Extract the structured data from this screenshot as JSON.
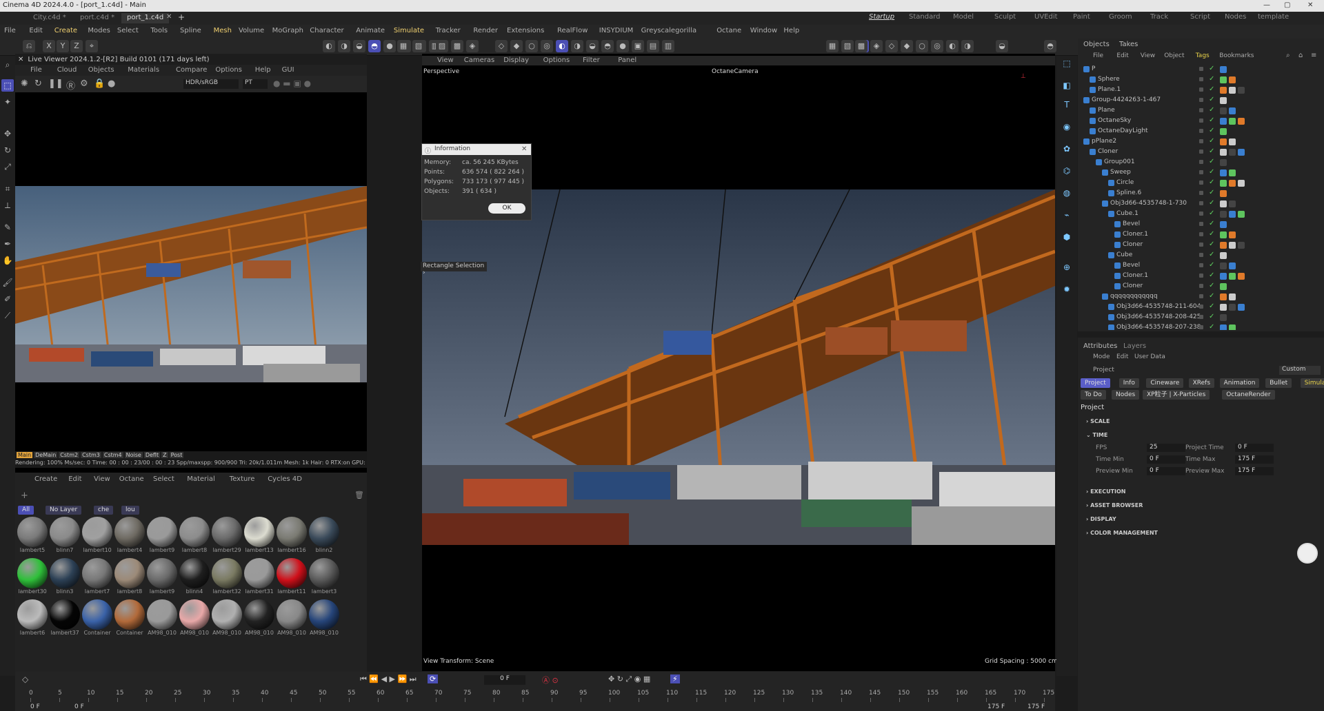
{
  "window": {
    "title": "Cinema 4D 2024.4.0 - [port_1.c4d] - Main"
  },
  "file_tabs": [
    "City.c4d *",
    "port.c4d *",
    "port_1.c4d"
  ],
  "layouts": [
    "Startup",
    "Standard",
    "Model",
    "Sculpt",
    "UVEdit",
    "Paint",
    "Groom",
    "Track",
    "Script",
    "Nodes",
    "template"
  ],
  "menu": [
    "File",
    "Edit",
    "Create",
    "Modes",
    "Select",
    "Tools",
    "Spline",
    "Mesh",
    "Volume",
    "MoGraph",
    "Character",
    "Animate",
    "Simulate",
    "Tracker",
    "Render",
    "Extensions",
    "RealFlow",
    "INSYDIUM",
    "Greyscalegorilla",
    "Octane",
    "Window",
    "Help"
  ],
  "coords": {
    "x": "X",
    "y": "Y",
    "z": "Z"
  },
  "live_viewer": {
    "title": "Live Viewer 2024.1.2-[R2] Build 0101 (171 days left)",
    "menu": [
      "File",
      "Cloud",
      "Objects",
      "Materials",
      "Compare",
      "Options",
      "Help",
      "GUI"
    ],
    "color_space": "HDR/sRGB",
    "pt": "PT",
    "chips": [
      "Main",
      "DeMain",
      "Cstm2",
      "Cstm3",
      "Cstm4",
      "Noise",
      "Deflt",
      "Z",
      "Post"
    ],
    "status": "Rendering: 100%  Ms/sec: 0  Time: 00 : 00 : 23/00 : 00 : 23  Spp/maxspp: 900/900    Tri: 20k/1.011m  Mesh: 1k  Hair: 0  RTX:on    GPU:"
  },
  "materials": {
    "menu": [
      "Create",
      "Edit",
      "View",
      "Octane",
      "Select",
      "Material",
      "Texture",
      "Cycles 4D"
    ],
    "filters": [
      "All",
      "No Layer",
      "che",
      "lou"
    ],
    "items": [
      {
        "name": "lambert5",
        "color": "#7a7a7a"
      },
      {
        "name": "blinn7",
        "color": "#8a8a8a"
      },
      {
        "name": "lambert10",
        "color": "#a0a0a0"
      },
      {
        "name": "lambert4",
        "color": "#6e6a62"
      },
      {
        "name": "lambert9",
        "color": "#9a9a9a"
      },
      {
        "name": "lambert8",
        "color": "#8c8c8c"
      },
      {
        "name": "lambert29",
        "color": "#6a6a6a"
      },
      {
        "name": "lambert13",
        "color": "#dcdcd0"
      },
      {
        "name": "lambert16",
        "color": "#7a7a72"
      },
      {
        "name": "blinn2",
        "color": "#3a4a5a"
      },
      {
        "name": "lambert30",
        "color": "#2fc03a"
      },
      {
        "name": "blinn3",
        "color": "#2c4055"
      },
      {
        "name": "lambert7",
        "color": "#777"
      },
      {
        "name": "lambert8",
        "color": "#9c8a78"
      },
      {
        "name": "lambert9",
        "color": "#6a6a6a"
      },
      {
        "name": "blinn4",
        "color": "#1e1e1e"
      },
      {
        "name": "lambert32",
        "color": "#7a7a62"
      },
      {
        "name": "lambert31",
        "color": "#9a9a9a"
      },
      {
        "name": "lambert11",
        "color": "#d0101a"
      },
      {
        "name": "lambert3",
        "color": "#5a5a5a"
      },
      {
        "name": "lambert6",
        "color": "#bbbbbb"
      },
      {
        "name": "lambert37",
        "color": "#050505"
      },
      {
        "name": "Container",
        "color": "#3a62a8"
      },
      {
        "name": "Container",
        "color": "#b26a3a"
      },
      {
        "name": "AM98_010",
        "color": "#9a9a9a"
      },
      {
        "name": "AM98_010",
        "color": "#e8a8a8"
      },
      {
        "name": "AM98_010",
        "color": "#b0b0b0"
      },
      {
        "name": "AM98_010",
        "color": "#222"
      },
      {
        "name": "AM98_010",
        "color": "#888"
      },
      {
        "name": "AM98_010",
        "color": "#26457a"
      }
    ]
  },
  "viewport": {
    "menu": [
      "View",
      "Cameras",
      "Display",
      "Options",
      "Filter",
      "Panel"
    ],
    "label": "Perspective",
    "camera": "OctaneCamera",
    "view_transform": "View Transform: Scene",
    "grid_spacing": "Grid Spacing : 5000 cm",
    "rect_selection": "Rectangle Selection"
  },
  "info_dialog": {
    "title": "Information",
    "rows": [
      {
        "k": "Memory:",
        "v": "ca. 56 245 KBytes"
      },
      {
        "k": "Points:",
        "v": "636 574 ( 822 264 )"
      },
      {
        "k": "Polygons:",
        "v": "733 173 ( 977 445 )"
      },
      {
        "k": "Objects:",
        "v": "391 ( 634 )"
      }
    ],
    "ok": "OK"
  },
  "timeline": {
    "frame": "0 F",
    "start": "0 F",
    "start2": "0 F",
    "end": "175 F",
    "end2": "175 F",
    "ticks": [
      "0",
      "5",
      "10",
      "15",
      "20",
      "25",
      "30",
      "35",
      "40",
      "45",
      "50",
      "55",
      "60",
      "65",
      "70",
      "75",
      "80",
      "85",
      "90",
      "95",
      "100",
      "105",
      "110",
      "115",
      "120",
      "125",
      "130",
      "135",
      "140",
      "145",
      "150",
      "155",
      "160",
      "165",
      "170",
      "175"
    ]
  },
  "objects_panel": {
    "tabs": [
      "Objects",
      "Takes"
    ],
    "menu": [
      "File",
      "Edit",
      "View",
      "Object",
      "Tags",
      "Bookmarks"
    ],
    "items": [
      {
        "name": "P",
        "indent": 0
      },
      {
        "name": "Sphere",
        "indent": 1
      },
      {
        "name": "Plane.1",
        "indent": 1
      },
      {
        "name": "Group-4424263-1-467",
        "indent": 0
      },
      {
        "name": "Plane",
        "indent": 1
      },
      {
        "name": "OctaneSky",
        "indent": 1
      },
      {
        "name": "OctaneDayLight",
        "indent": 1
      },
      {
        "name": "pPlane2",
        "indent": 0
      },
      {
        "name": "Cloner",
        "indent": 1
      },
      {
        "name": "Group001",
        "indent": 2
      },
      {
        "name": "Sweep",
        "indent": 3
      },
      {
        "name": "Circle",
        "indent": 4
      },
      {
        "name": "Spline.6",
        "indent": 4
      },
      {
        "name": "Obj3d66-4535748-1-730",
        "indent": 3
      },
      {
        "name": "Cube.1",
        "indent": 4
      },
      {
        "name": "Bevel",
        "indent": 5
      },
      {
        "name": "Cloner.1",
        "indent": 5
      },
      {
        "name": "Cloner",
        "indent": 5
      },
      {
        "name": "Cube",
        "indent": 4
      },
      {
        "name": "Bevel",
        "indent": 5
      },
      {
        "name": "Cloner.1",
        "indent": 5
      },
      {
        "name": "Cloner",
        "indent": 5
      },
      {
        "name": "qqqqqqqqqqqq",
        "indent": 3
      },
      {
        "name": "Obj3d66-4535748-211-604",
        "indent": 4
      },
      {
        "name": "Obj3d66-4535748-208-425",
        "indent": 4
      },
      {
        "name": "Obj3d66-4535748-207-238",
        "indent": 4
      }
    ]
  },
  "attributes": {
    "tabs": [
      "Attributes",
      "Layers"
    ],
    "menu": [
      "Mode",
      "Edit",
      "User Data"
    ],
    "project_label": "Project",
    "preset": "Custom",
    "buttons_row1": [
      "Project",
      "Info",
      "Cineware",
      "XRefs",
      "Animation",
      "Bullet",
      "Simulation"
    ],
    "buttons_row2": [
      "To Do",
      "Nodes",
      "XP粒子 | X-Particles",
      "OctaneRender"
    ],
    "section": "Project",
    "sections": [
      "SCALE",
      "TIME",
      "EXECUTION",
      "ASSET BROWSER",
      "DISPLAY",
      "COLOR MANAGEMENT"
    ],
    "fields": [
      {
        "label": "FPS",
        "value": "25"
      },
      {
        "label": "Project Time",
        "value": "0 F"
      },
      {
        "label": "Time Min",
        "value": "0 F"
      },
      {
        "label": "Time Max",
        "value": "175 F"
      },
      {
        "label": "Preview Min",
        "value": "0 F"
      },
      {
        "label": "Preview Max",
        "value": "175 F"
      }
    ]
  }
}
